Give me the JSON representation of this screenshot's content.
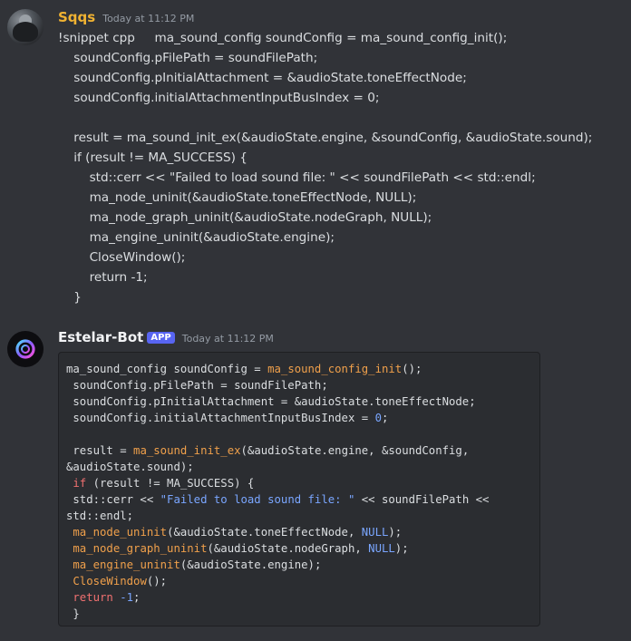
{
  "messages": [
    {
      "author": "Sqqs",
      "author_color": "#f0b232",
      "timestamp": "Today at 11:12 PM",
      "lines": [
        "!snippet cpp     ma_sound_config soundConfig = ma_sound_config_init();",
        "    soundConfig.pFilePath = soundFilePath;",
        "    soundConfig.pInitialAttachment = &audioState.toneEffectNode;",
        "    soundConfig.initialAttachmentInputBusIndex = 0;",
        "",
        "    result = ma_sound_init_ex(&audioState.engine, &soundConfig, &audioState.sound);",
        "    if (result != MA_SUCCESS) {",
        "        std::cerr << \"Failed to load sound file: \" << soundFilePath << std::endl;",
        "        ma_node_uninit(&audioState.toneEffectNode, NULL);",
        "        ma_node_graph_uninit(&audioState.nodeGraph, NULL);",
        "        ma_engine_uninit(&audioState.engine);",
        "        CloseWindow();",
        "        return -1;",
        "    }"
      ]
    },
    {
      "author": "Estelar-Bot",
      "author_color": "#f2f3f5",
      "badge": "APP",
      "timestamp": "Today at 11:12 PM",
      "code_lines": [
        [
          {
            "t": "ma_sound_config soundConfig = ",
            "c": "plain"
          },
          {
            "t": "ma_sound_config_init",
            "c": "fn"
          },
          {
            "t": "();",
            "c": "plain"
          }
        ],
        [
          {
            "t": " soundConfig.pFilePath = soundFilePath;",
            "c": "plain"
          }
        ],
        [
          {
            "t": " soundConfig.pInitialAttachment = &audioState.toneEffectNode;",
            "c": "plain"
          }
        ],
        [
          {
            "t": " soundConfig.initialAttachmentInputBusIndex = ",
            "c": "plain"
          },
          {
            "t": "0",
            "c": "num"
          },
          {
            "t": ";",
            "c": "plain"
          }
        ],
        [
          {
            "t": "",
            "c": "plain"
          }
        ],
        [
          {
            "t": " result = ",
            "c": "plain"
          },
          {
            "t": "ma_sound_init_ex",
            "c": "fn"
          },
          {
            "t": "(&audioState.engine, &soundConfig,",
            "c": "plain"
          }
        ],
        [
          {
            "t": "&audioState.sound);",
            "c": "plain"
          }
        ],
        [
          {
            "t": " ",
            "c": "plain"
          },
          {
            "t": "if",
            "c": "kw"
          },
          {
            "t": " (result != MA_SUCCESS) {",
            "c": "plain"
          }
        ],
        [
          {
            "t": " std::cerr << ",
            "c": "plain"
          },
          {
            "t": "\"Failed to load sound file: \"",
            "c": "str"
          },
          {
            "t": " << soundFilePath <<",
            "c": "plain"
          }
        ],
        [
          {
            "t": "std::endl;",
            "c": "plain"
          }
        ],
        [
          {
            "t": " ",
            "c": "plain"
          },
          {
            "t": "ma_node_uninit",
            "c": "fn"
          },
          {
            "t": "(&audioState.toneEffectNode, ",
            "c": "plain"
          },
          {
            "t": "NULL",
            "c": "num"
          },
          {
            "t": ");",
            "c": "plain"
          }
        ],
        [
          {
            "t": " ",
            "c": "plain"
          },
          {
            "t": "ma_node_graph_uninit",
            "c": "fn"
          },
          {
            "t": "(&audioState.nodeGraph, ",
            "c": "plain"
          },
          {
            "t": "NULL",
            "c": "num"
          },
          {
            "t": ");",
            "c": "plain"
          }
        ],
        [
          {
            "t": " ",
            "c": "plain"
          },
          {
            "t": "ma_engine_uninit",
            "c": "fn"
          },
          {
            "t": "(&audioState.engine);",
            "c": "plain"
          }
        ],
        [
          {
            "t": " ",
            "c": "plain"
          },
          {
            "t": "CloseWindow",
            "c": "fn"
          },
          {
            "t": "();",
            "c": "plain"
          }
        ],
        [
          {
            "t": " ",
            "c": "plain"
          },
          {
            "t": "return",
            "c": "kw"
          },
          {
            "t": " ",
            "c": "plain"
          },
          {
            "t": "-1",
            "c": "num"
          },
          {
            "t": ";",
            "c": "plain"
          }
        ],
        [
          {
            "t": " }",
            "c": "plain"
          }
        ]
      ]
    }
  ],
  "colors": {
    "background": "#313338",
    "codeblock_bg": "#2b2d31",
    "fn": "#f0a04b",
    "keyword": "#f07070",
    "number": "#7aa6ff",
    "app_badge": "#5865f2"
  }
}
